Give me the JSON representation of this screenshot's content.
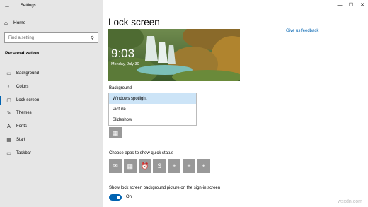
{
  "window": {
    "title": "Settings",
    "controls": {
      "minimize": "—",
      "maximize": "☐",
      "close": "✕"
    }
  },
  "sidebar": {
    "home_label": "Home",
    "search_placeholder": "Find a setting",
    "section_title": "Personalization",
    "items": [
      {
        "label": "Background",
        "icon": "image-icon",
        "active": false
      },
      {
        "label": "Colors",
        "icon": "palette-icon",
        "active": false
      },
      {
        "label": "Lock screen",
        "icon": "lock-screen-icon",
        "active": true
      },
      {
        "label": "Themes",
        "icon": "brush-icon",
        "active": false
      },
      {
        "label": "Fonts",
        "icon": "font-icon",
        "active": false
      },
      {
        "label": "Start",
        "icon": "start-icon",
        "active": false
      },
      {
        "label": "Taskbar",
        "icon": "taskbar-icon",
        "active": false
      }
    ]
  },
  "main": {
    "heading": "Lock screen",
    "feedback_link": "Give us feedback",
    "preview": {
      "time": "9:03",
      "date": "Monday, July 30"
    },
    "background_label": "Background",
    "background_options": [
      "Windows spotlight",
      "Picture",
      "Slideshow"
    ],
    "selected_option": "Windows spotlight",
    "quick_status_label": "Choose apps to show quick status",
    "quick_status_icons": [
      "mail-icon",
      "calendar-icon",
      "alarm-icon",
      "skype-icon",
      "plus-icon",
      "plus-icon",
      "plus-icon"
    ],
    "show_bg_label": "Show lock screen background picture on the sign-in screen",
    "toggle_state": "On"
  },
  "watermark": "wsxdn.com"
}
